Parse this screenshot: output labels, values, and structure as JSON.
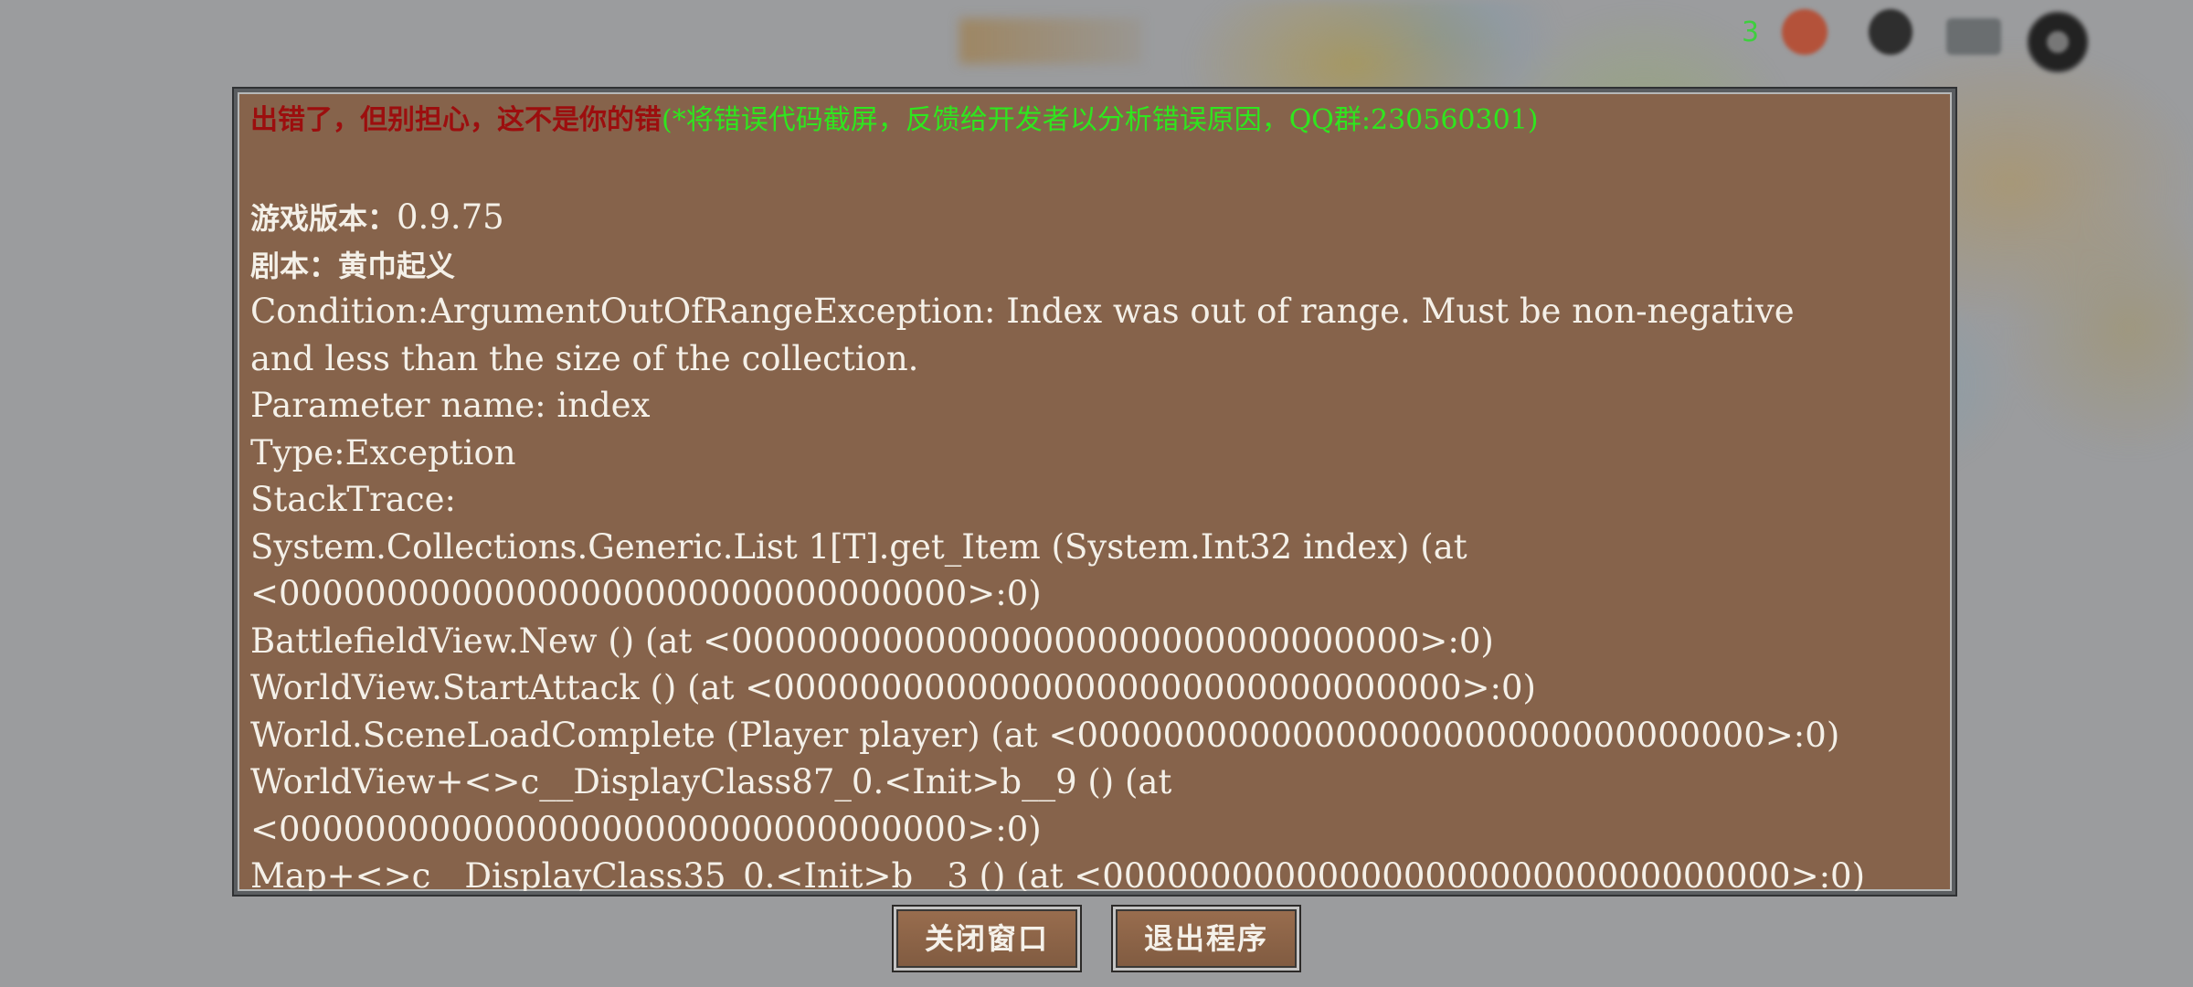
{
  "hud": {
    "counter": "3"
  },
  "dialog": {
    "header_red": "出错了，但别担心，这不是你的错",
    "header_green": "(*将错误代码截屏，反馈给开发者以分析错误原因，QQ群:230560301)",
    "version_label": "游戏版本：",
    "version_value": "0.9.75",
    "script_label": "剧本：",
    "script_value": "黄巾起义",
    "lines": [
      "Condition:ArgumentOutOfRangeException: Index was out of range. Must be non-negative",
      "and less than the size of the collection.",
      "Parameter name: index",
      "Type:Exception",
      "StackTrace:",
      "System.Collections.Generic.List 1[T].get_Item (System.Int32 index) (at",
      "<00000000000000000000000000000000>:0)",
      "BattlefieldView.New () (at <00000000000000000000000000000000>:0)",
      "WorldView.StartAttack () (at <00000000000000000000000000000000>:0)",
      "World.SceneLoadComplete (Player player) (at <00000000000000000000000000000000>:0)",
      "WorldView+<>c__DisplayClass87_0.<Init>b__9 () (at",
      "<00000000000000000000000000000000>:0)",
      "Map+<>c__DisplayClass35_0.<Init>b__3 () (at <00000000000000000000000000000000>:0)"
    ]
  },
  "buttons": {
    "close": "关闭窗口",
    "quit": "退出程序"
  },
  "colors": {
    "dialog_bg": "#86634b",
    "header_red": "#9c0e0e",
    "header_green": "#2fe61e",
    "text": "#f4f0e8"
  }
}
